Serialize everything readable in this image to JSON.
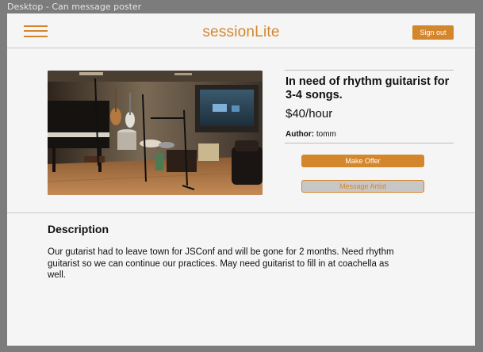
{
  "frame": {
    "label": "Desktop - Can message poster"
  },
  "header": {
    "brand": "sessionLite",
    "menu_icon": "hamburger-menu-icon",
    "sign_out_label": "Sign out",
    "accent_color": "#d4862d"
  },
  "post": {
    "title": "In need of rhythm guitarist for 3-4 songs.",
    "price": "$40/hour",
    "author_label": "Author:",
    "author_name": "tomm",
    "make_offer_label": "Make Offer",
    "message_artist_label": "Message Artist"
  },
  "description": {
    "heading": "Description",
    "body": "Our gutarist had to leave town for JSConf and will be gone for 2 months. Need rhythm guitarist so we can continue our practices. May need guitarist to fill in at coachella as well."
  }
}
